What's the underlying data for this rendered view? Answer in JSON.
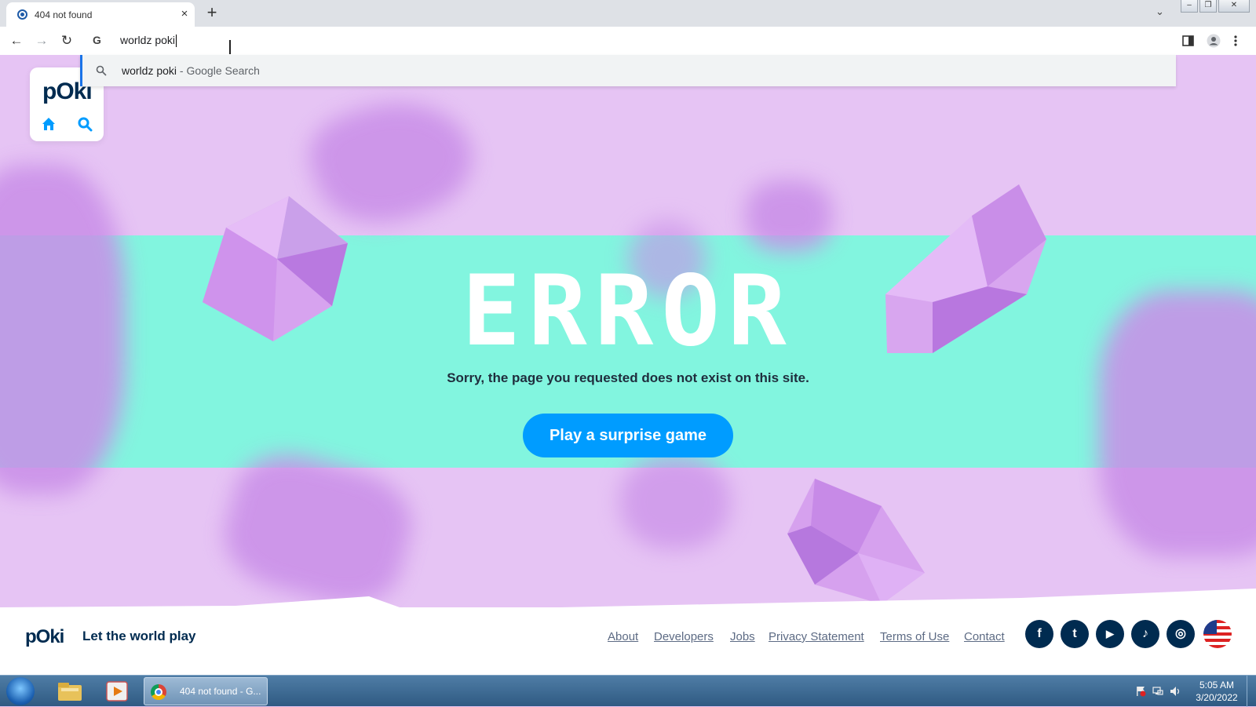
{
  "browser": {
    "tab_title": "404 not found",
    "tab_close": "×",
    "new_tab": "+",
    "tab_dropdown": "⌄",
    "window_buttons": [
      "–",
      "❐",
      "✕"
    ],
    "nav": {
      "back": "←",
      "forward": "→",
      "reload": "↻"
    },
    "omnibox_icon": "G",
    "omnibox_value": "worldz poki",
    "suggestion": {
      "query": "worldz poki",
      "suffix": " - Google Search"
    }
  },
  "page": {
    "sidecard": {
      "logo": "pOki"
    },
    "error_title": "ERROR",
    "error_message": "Sorry, the page you requested does not exist on this site.",
    "cta_label": "Play a surprise game",
    "footer": {
      "logo": "pOki",
      "tagline": "Let the world play",
      "links": [
        "About",
        "Developers",
        "Jobs",
        "Privacy Statement",
        "Terms of Use",
        "Contact"
      ],
      "social": [
        {
          "name": "facebook-icon",
          "glyph": "f"
        },
        {
          "name": "twitter-icon",
          "glyph": "t"
        },
        {
          "name": "youtube-icon",
          "glyph": "▶"
        },
        {
          "name": "tiktok-icon",
          "glyph": "♪"
        },
        {
          "name": "instagram-icon",
          "glyph": "◎"
        }
      ]
    },
    "colors": {
      "background": "#e6c4f4",
      "band": "#82f5df",
      "cta": "#009cff",
      "navy": "#002b50"
    }
  },
  "taskbar": {
    "chrome_label": "404 not found - G...",
    "time": "5:05 AM",
    "date": "3/20/2022"
  }
}
